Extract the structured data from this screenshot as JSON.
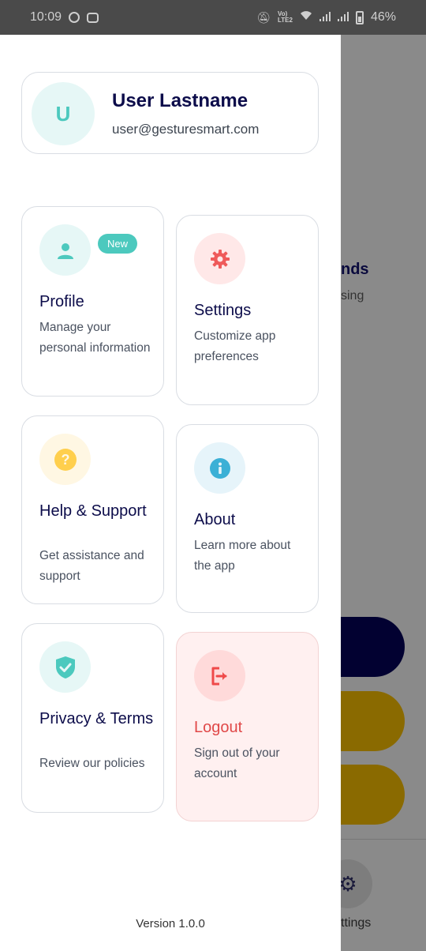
{
  "status_bar": {
    "time": "10:09",
    "battery": "46%",
    "left_icons": [
      "whatsapp-icon",
      "game-icon"
    ],
    "right_icons": [
      "mute-icon",
      "volte-icon",
      "wifi-icon",
      "signal-icon",
      "signal-icon",
      "battery-icon"
    ]
  },
  "user": {
    "initial": "U",
    "name": "User Lastname",
    "email": "user@gesturesmart.com"
  },
  "menu": {
    "profile": {
      "title": "Profile",
      "description": "Manage your personal information",
      "badge": "New",
      "icon": "person-icon"
    },
    "settings": {
      "title": "Settings",
      "description": "Customize app preferences",
      "icon": "gear-icon"
    },
    "help": {
      "title": "Help & Support",
      "description": "Get assistance and support",
      "icon": "question-icon"
    },
    "about": {
      "title": "About",
      "description": "Learn more about the app",
      "icon": "info-icon"
    },
    "privacy": {
      "title": "Privacy & Terms",
      "description": "Review our policies",
      "icon": "shield-check-icon"
    },
    "logout": {
      "title": "Logout",
      "description": "Sign out of your account",
      "icon": "logout-icon"
    }
  },
  "version": "Version 1.0.0",
  "background_app": {
    "text1": "nds",
    "text2": "sing",
    "nav_label": "ttings"
  },
  "colors": {
    "accent_teal": "#4cc9be",
    "title_navy": "#0c0c4a",
    "logout_red": "#e04848",
    "logout_bg": "#fff0f0"
  }
}
